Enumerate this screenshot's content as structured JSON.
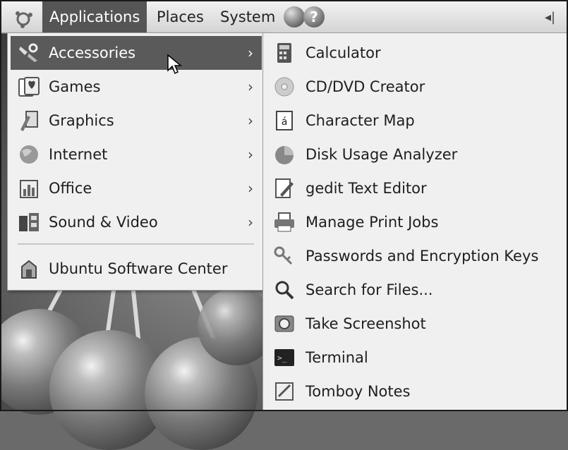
{
  "panel": {
    "menus": [
      "Applications",
      "Places",
      "System"
    ],
    "help_glyph": "?",
    "volume_glyph": "◂|"
  },
  "applications_menu": {
    "items": [
      {
        "label": "Accessories",
        "icon": "accessories-icon",
        "has_submenu": true
      },
      {
        "label": "Games",
        "icon": "games-icon",
        "has_submenu": true
      },
      {
        "label": "Graphics",
        "icon": "graphics-icon",
        "has_submenu": true
      },
      {
        "label": "Internet",
        "icon": "internet-icon",
        "has_submenu": true
      },
      {
        "label": "Office",
        "icon": "office-icon",
        "has_submenu": true
      },
      {
        "label": "Sound & Video",
        "icon": "sound-video-icon",
        "has_submenu": true
      }
    ],
    "software_center": {
      "label": "Ubuntu Software Center",
      "icon": "software-center-icon"
    },
    "arrow": "›"
  },
  "accessories_submenu": {
    "items": [
      {
        "label": "Calculator",
        "icon": "calculator-icon"
      },
      {
        "label": "CD/DVD Creator",
        "icon": "cd-dvd-icon"
      },
      {
        "label": "Character Map",
        "icon": "character-map-icon",
        "glyph": "á"
      },
      {
        "label": "Disk Usage Analyzer",
        "icon": "disk-usage-icon"
      },
      {
        "label": "gedit Text Editor",
        "icon": "text-editor-icon"
      },
      {
        "label": "Manage Print Jobs",
        "icon": "printer-icon"
      },
      {
        "label": "Passwords and Encryption Keys",
        "icon": "keys-icon"
      },
      {
        "label": "Search for Files...",
        "icon": "search-icon"
      },
      {
        "label": "Take Screenshot",
        "icon": "camera-icon"
      },
      {
        "label": "Terminal",
        "icon": "terminal-icon",
        "glyph": ">_"
      },
      {
        "label": "Tomboy Notes",
        "icon": "notes-icon"
      }
    ]
  },
  "colors": {
    "highlight": "#5a5a5a",
    "menu_bg": "#f0f0f0"
  }
}
